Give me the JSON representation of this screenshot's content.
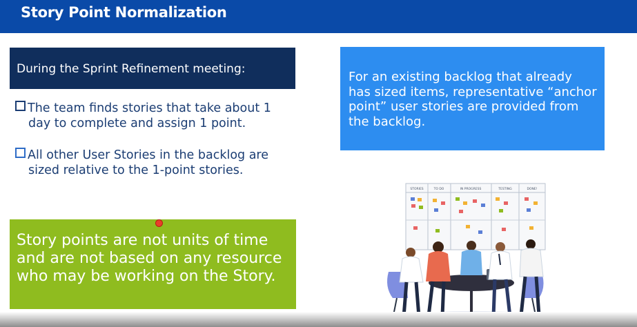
{
  "slide": {
    "title": "Story Point Normalization",
    "header_box": "During the Sprint Refinement meeting:",
    "bullets": [
      {
        "line1": "The team finds stories that take about 1",
        "line2": "day to complete and assign 1 point."
      },
      {
        "line1": "All other User Stories in the backlog are",
        "line2": "sized relative to the 1-point stories."
      }
    ],
    "callout_green": "Story points are not units of time and are not based on any resource who may be working on the Story.",
    "callout_blue": "For an existing backlog that already has sized items, representative “anchor point” user stories are provided from the backlog."
  },
  "illustration": {
    "board_columns": [
      "STORIES",
      "TO DO",
      "IN PROGRESS",
      "TESTING",
      "DONE!"
    ],
    "icon": "team-meeting-kanban-illustration"
  },
  "colors": {
    "title_bar": "#0a4aa8",
    "dark_box": "#102e5c",
    "green_box": "#8fbc1f",
    "blue_box": "#2d8df0",
    "bullet_text": "#1b3d73"
  }
}
